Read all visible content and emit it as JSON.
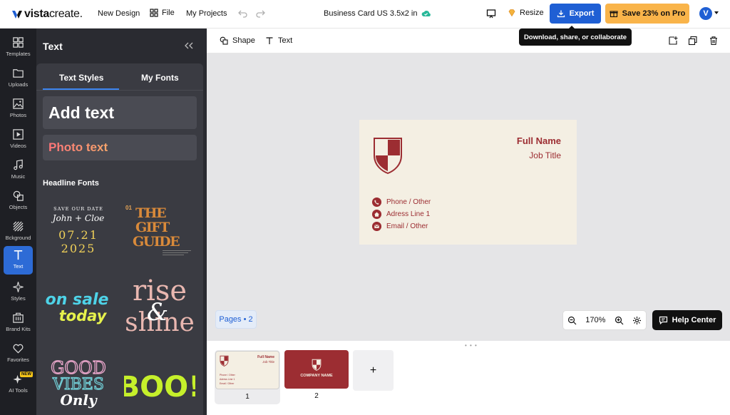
{
  "header": {
    "logo_text_bold": "vista",
    "logo_text_light": "create.",
    "new_design": "New Design",
    "file": "File",
    "my_projects": "My Projects",
    "document_title": "Business Card US 3.5x2 in",
    "resize": "Resize",
    "export": "Export",
    "upgrade": "Save 23% on Pro",
    "avatar_initial": "V",
    "tooltip": "Download, share, or collaborate"
  },
  "rail": {
    "items": [
      {
        "label": "Templates",
        "icon": "templates-icon"
      },
      {
        "label": "Uploads",
        "icon": "uploads-icon"
      },
      {
        "label": "Photos",
        "icon": "photos-icon"
      },
      {
        "label": "Videos",
        "icon": "videos-icon"
      },
      {
        "label": "Music",
        "icon": "music-icon"
      },
      {
        "label": "Objects",
        "icon": "objects-icon"
      },
      {
        "label": "Bckground",
        "icon": "background-icon"
      },
      {
        "label": "Text",
        "icon": "text-icon",
        "active": true
      },
      {
        "label": "Styles",
        "icon": "styles-icon"
      },
      {
        "label": "Brand Kits",
        "icon": "brand-kits-icon"
      },
      {
        "label": "Favorites",
        "icon": "favorites-icon"
      },
      {
        "label": "AI Tools",
        "icon": "ai-tools-icon",
        "badge": "NEW"
      }
    ]
  },
  "panel": {
    "title": "Text",
    "tabs": [
      {
        "label": "Text Styles",
        "active": true
      },
      {
        "label": "My Fonts"
      }
    ],
    "add_text": "Add text",
    "photo_text": "Photo text",
    "headline_fonts_label": "Headline Fonts",
    "font_samples": {
      "save_date_top": "SAVE OUR DATE",
      "save_date_names": "John + Cloe",
      "save_date_date1": "07.21",
      "save_date_date2": "2025",
      "gift_num": "01",
      "gift_line1": "THE",
      "gift_line2": "GIFT",
      "gift_line3": "GUIDE",
      "on_sale_1": "on sale",
      "on_sale_2": "today",
      "rise_1": "rise",
      "rise_amp": "&",
      "rise_2": "shine",
      "good_1": "GOOD",
      "good_2": "VIBES",
      "good_3": "Only",
      "boo": "BOO!"
    }
  },
  "toolbar": {
    "shape": "Shape",
    "text": "Text"
  },
  "card": {
    "full_name": "Full Name",
    "job_title": "Job Title",
    "phone": "Phone / Other",
    "address": "Adress Line 1",
    "email": "Email / Other",
    "accent_color": "#9c2d32",
    "background_color": "#f4efe3"
  },
  "canvas": {
    "pages_chip": "Pages • 2",
    "zoom": "170%",
    "help_center": "Help Center"
  },
  "pages": [
    {
      "number": "1",
      "full_name": "Full Name",
      "job_title": "Job Title",
      "rows": [
        "Phone / Other",
        "Adress Line 1",
        "Email / Other"
      ]
    },
    {
      "number": "2",
      "company": "COMPANY NAME"
    }
  ],
  "add_page": "+"
}
